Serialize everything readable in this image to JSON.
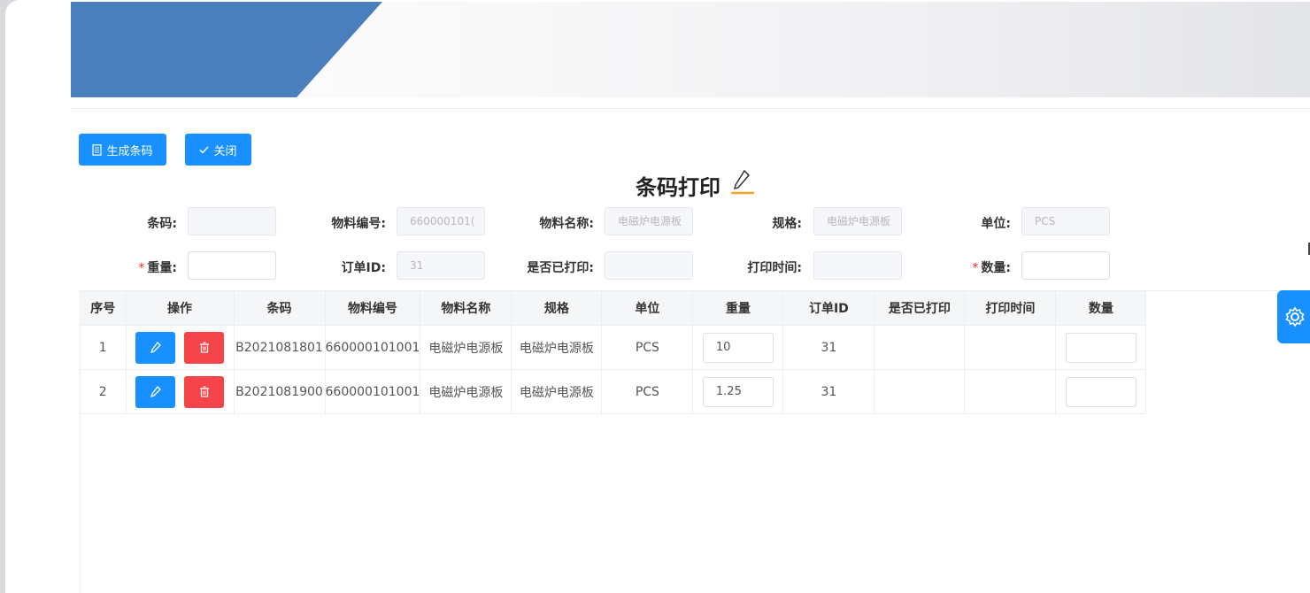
{
  "toolbar": {
    "generate_label": "生成条码",
    "close_label": "关闭"
  },
  "title": "条码打印",
  "form": {
    "barcode_label": "条码:",
    "barcode_value": "",
    "material_code_label": "物料编号:",
    "material_code_value": "660000101(",
    "material_name_label": "物料名称:",
    "material_name_value": "电磁炉电源板",
    "spec_label": "规格:",
    "spec_value": "电磁炉电源板",
    "unit_label": "单位:",
    "unit_value": "PCS",
    "weight_label": "重量:",
    "weight_value": "",
    "order_id_label": "订单ID:",
    "order_id_value": "31",
    "printed_label": "是否已打印:",
    "printed_value": "",
    "print_time_label": "打印时间:",
    "print_time_value": "",
    "quantity_label": "数量:",
    "quantity_value": "",
    "required_mark": "*"
  },
  "table": {
    "headers": [
      "序号",
      "操作",
      "条码",
      "物料编号",
      "物料名称",
      "规格",
      "单位",
      "重量",
      "订单ID",
      "是否已打印",
      "打印时间",
      "数量"
    ],
    "rows": [
      {
        "index": "1",
        "barcode": "B2021081801",
        "material_code": "660000101001",
        "material_name": "电磁炉电源板",
        "spec": "电磁炉电源板",
        "unit": "PCS",
        "weight": "10",
        "order_id": "31",
        "printed": "",
        "print_time": "",
        "quantity": ""
      },
      {
        "index": "2",
        "barcode": "B2021081900",
        "material_code": "660000101001",
        "material_name": "电磁炉电源板",
        "spec": "电磁炉电源板",
        "unit": "PCS",
        "weight": "1.25",
        "order_id": "31",
        "printed": "",
        "print_time": "",
        "quantity": ""
      }
    ]
  },
  "colors": {
    "primary": "#1890ff",
    "danger": "#f5454b",
    "banner": "#4a7ebc"
  },
  "icons": {
    "generate": "document-icon",
    "close": "check-icon",
    "title": "pencil-icon",
    "edit": "edit-icon",
    "delete": "trash-icon",
    "settings": "gear-icon"
  }
}
